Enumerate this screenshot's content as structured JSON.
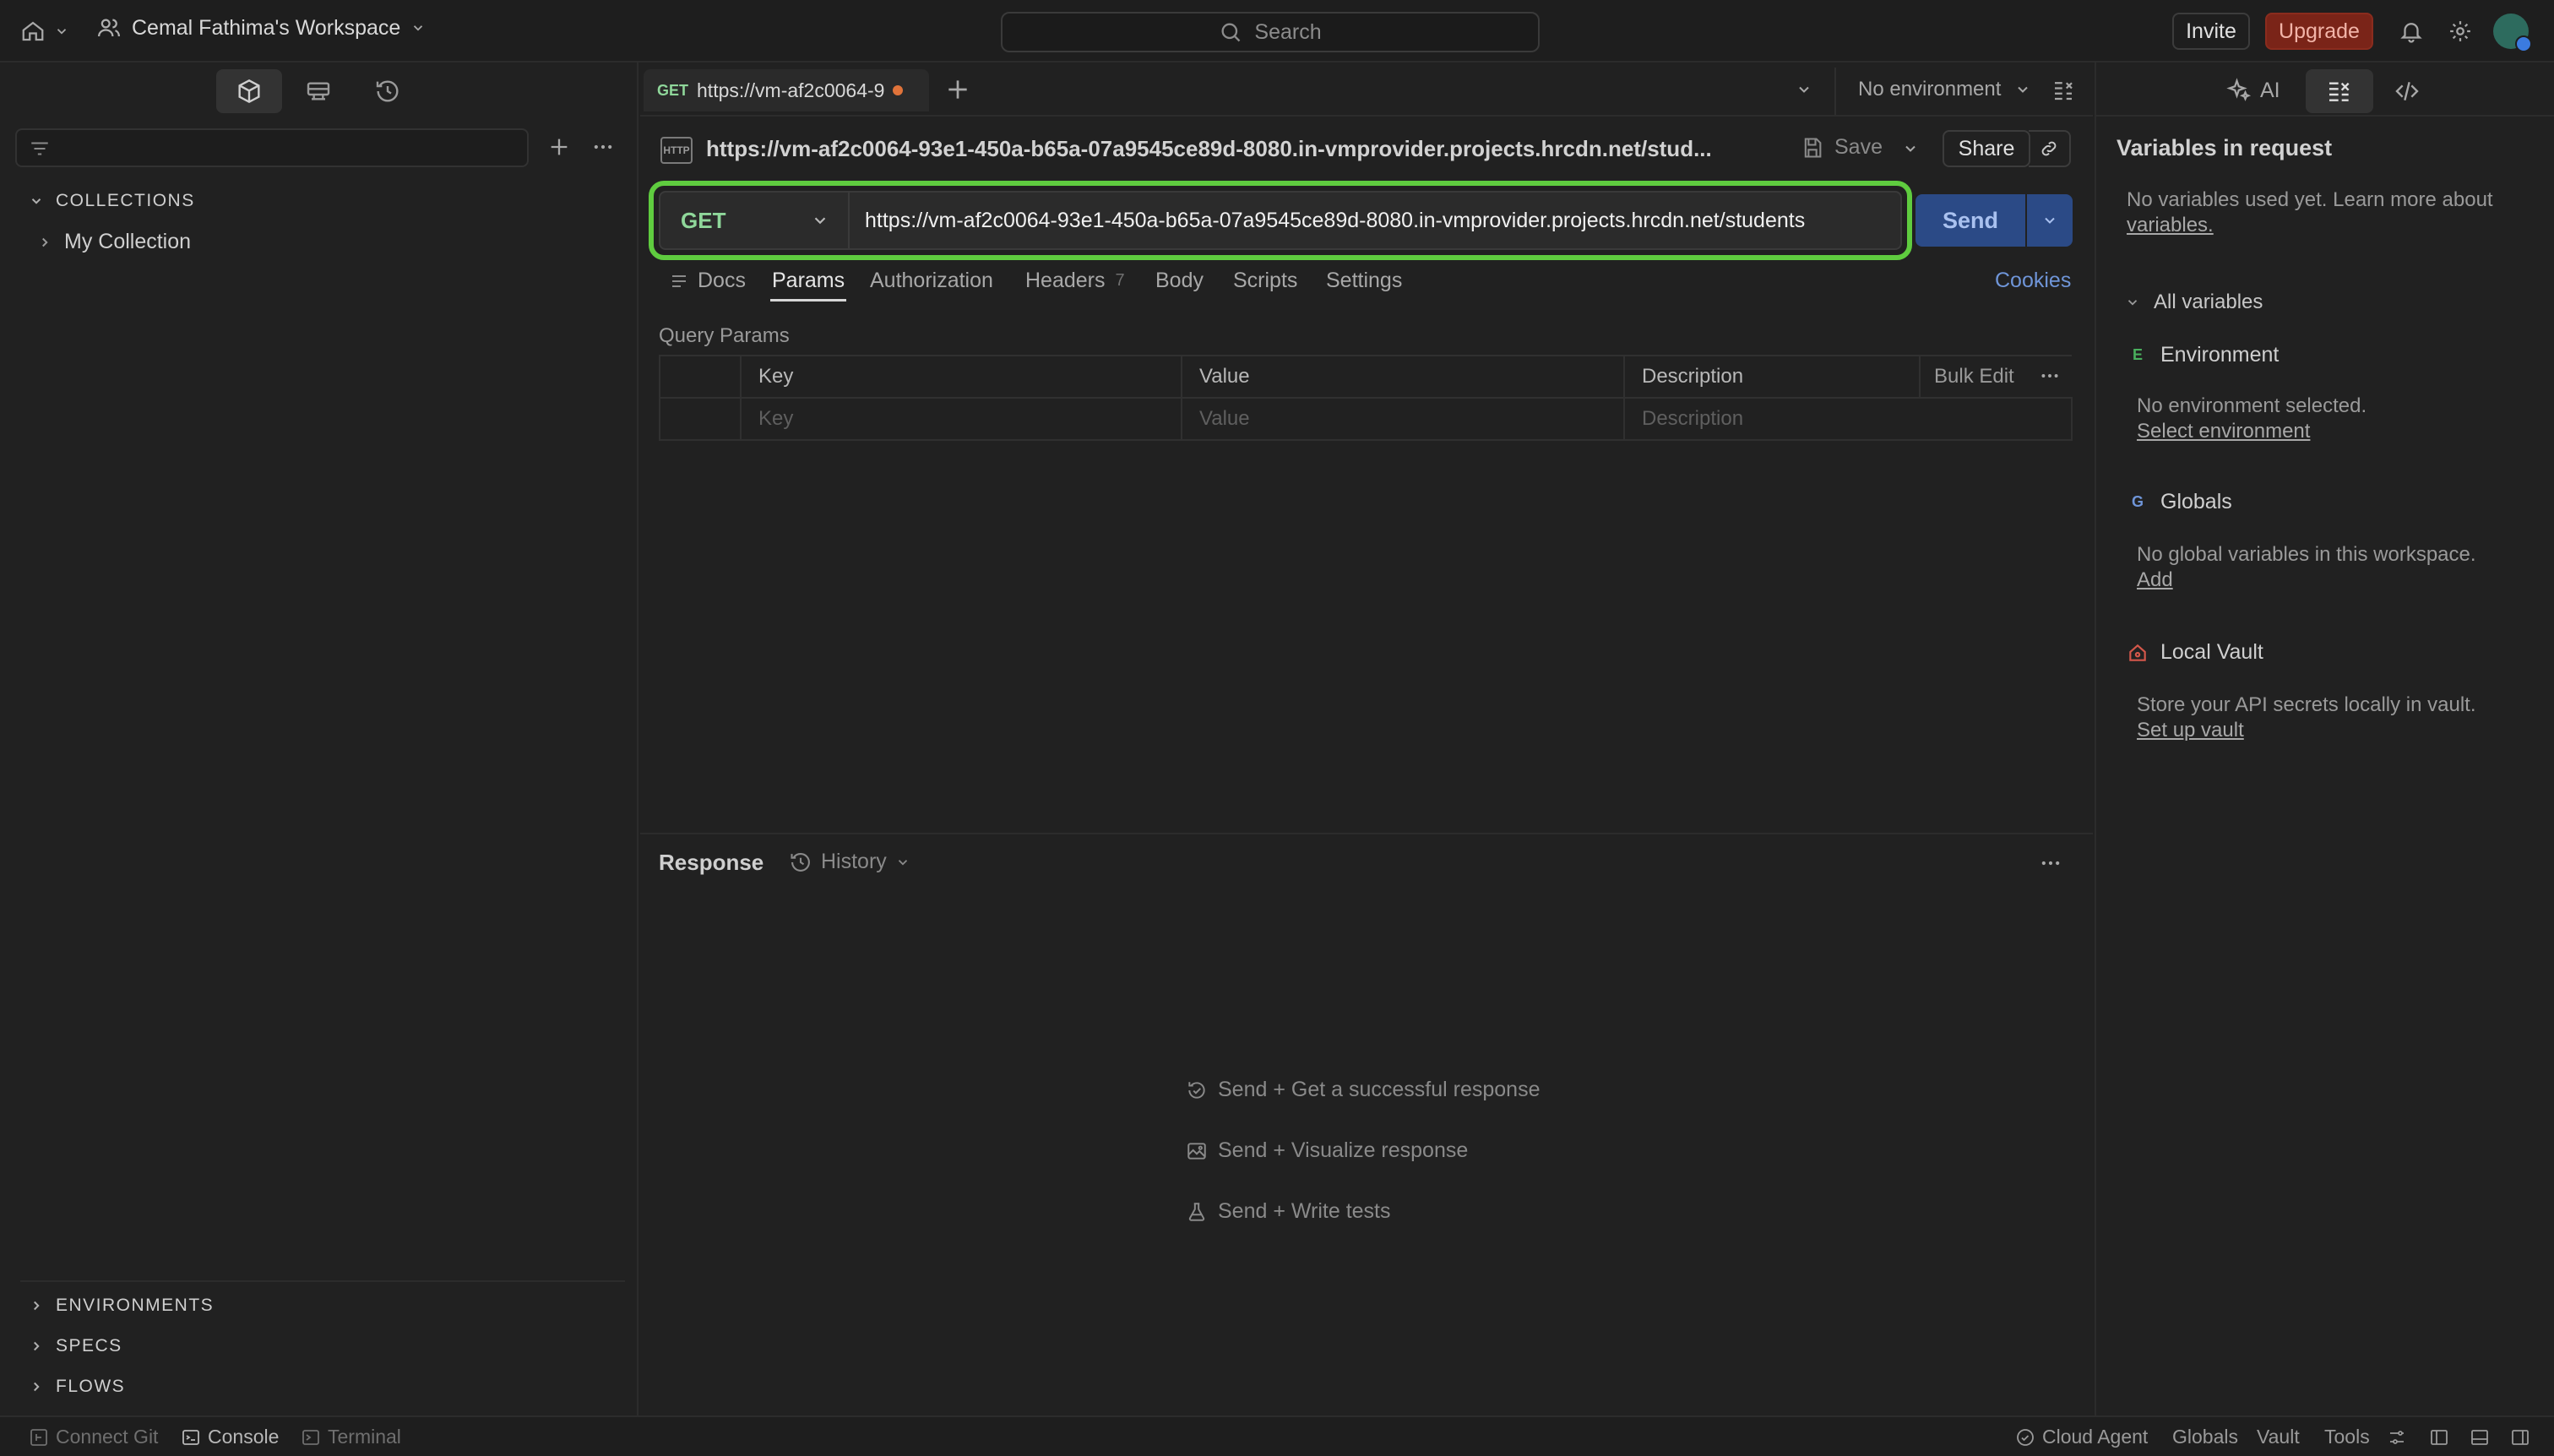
{
  "topbar": {
    "workspace_name": "Cemal Fathima's Workspace",
    "search_label": "Search",
    "invite_label": "Invite",
    "upgrade_label": "Upgrade"
  },
  "sidebar": {
    "collections_heading": "COLLECTIONS",
    "collection_items": [
      "My Collection"
    ],
    "environments_heading": "ENVIRONMENTS",
    "specs_heading": "SPECS",
    "flows_heading": "FLOWS"
  },
  "tabs": {
    "active_tab_method": "GET",
    "active_tab_label": "https://vm-af2c0064-9",
    "environment_select": "No environment"
  },
  "request": {
    "protocol_icon_label": "HTTP",
    "title": "https://vm-af2c0064-93e1-450a-b65a-07a9545ce89d-8080.in-vmprovider.projects.hrcdn.net/stud...",
    "save_label": "Save",
    "share_label": "Share",
    "method": "GET",
    "url": "https://vm-af2c0064-93e1-450a-b65a-07a9545ce89d-8080.in-vmprovider.projects.hrcdn.net/students",
    "send_label": "Send",
    "tabs": {
      "docs": "Docs",
      "params": "Params",
      "authorization": "Authorization",
      "headers": "Headers",
      "headers_count": "7",
      "body": "Body",
      "scripts": "Scripts",
      "settings": "Settings",
      "cookies": "Cookies"
    },
    "query_params_label": "Query Params",
    "params_table": {
      "key_header": "Key",
      "value_header": "Value",
      "description_header": "Description",
      "bulk_edit": "Bulk Edit",
      "key_placeholder": "Key",
      "value_placeholder": "Value",
      "description_placeholder": "Description"
    }
  },
  "response": {
    "title": "Response",
    "history_label": "History",
    "hints": [
      "Send + Get a successful response",
      "Send + Visualize response",
      "Send + Write tests"
    ]
  },
  "right_panel": {
    "ai_label": "AI",
    "title": "Variables in request",
    "no_vars_text": "No variables used yet. Learn more about",
    "no_vars_link": "variables.",
    "all_variables": "All variables",
    "environment": {
      "badge": "E",
      "label": "Environment",
      "text": "No environment selected.",
      "link": "Select environment"
    },
    "globals": {
      "badge": "G",
      "label": "Globals",
      "text": "No global variables in this workspace.",
      "link": "Add"
    },
    "vault": {
      "label": "Local Vault",
      "text": "Store your API secrets locally in vault.",
      "link": "Set up vault"
    }
  },
  "statusbar": {
    "connect_git": "Connect Git",
    "console": "Console",
    "terminal": "Terminal",
    "cloud_agent": "Cloud Agent",
    "globals": "Globals",
    "vault": "Vault",
    "tools": "Tools"
  },
  "colors": {
    "background": "#212121",
    "url_highlight": "#5fcc3f",
    "send_button": "#2b4a86",
    "upgrade_button": "#7a2418",
    "method_get": "#8fd79a",
    "link_blue": "#6f95d8"
  }
}
